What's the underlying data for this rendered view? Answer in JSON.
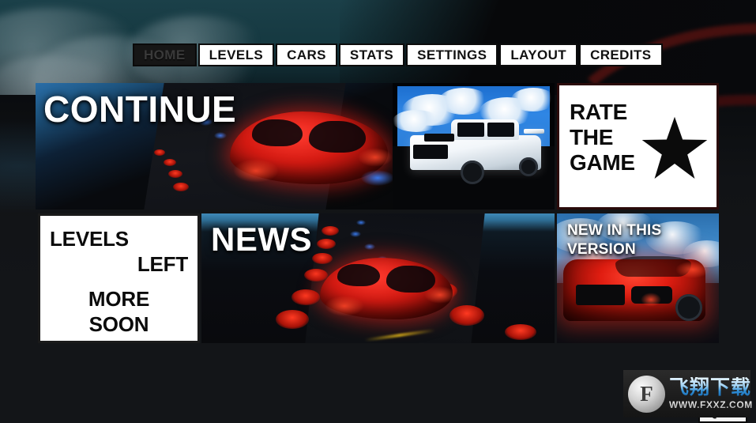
{
  "app": {
    "title": "Car Stunt Racing Game Main Menu"
  },
  "nav": {
    "tabs": [
      {
        "label": "HOME",
        "active": true,
        "name": "nav-tab-home"
      },
      {
        "label": "LEVELS",
        "active": false,
        "name": "nav-tab-levels"
      },
      {
        "label": "CARS",
        "active": false,
        "name": "nav-tab-cars"
      },
      {
        "label": "STATS",
        "active": false,
        "name": "nav-tab-stats"
      },
      {
        "label": "SETTINGS",
        "active": false,
        "name": "nav-tab-settings"
      },
      {
        "label": "LAYOUT",
        "active": false,
        "name": "nav-tab-layout"
      },
      {
        "label": "CREDITS",
        "active": false,
        "name": "nav-tab-credits"
      }
    ]
  },
  "tiles": {
    "continue": {
      "title": "CONTINUE",
      "image_desc": "red-hatchback-on-dark-track"
    },
    "truck": {
      "title": "",
      "image_desc": "white-pickup-truck-blue-sky"
    },
    "rate": {
      "line1": "RATE",
      "line2": "THE",
      "line3": "GAME",
      "icon": "star-icon"
    },
    "levels": {
      "line1": "LEVELS",
      "line2": "LEFT",
      "line3": "MORE",
      "line4": "SOON"
    },
    "news": {
      "title": "NEWS",
      "image_desc": "red-car-with-glowing-cones"
    },
    "version": {
      "line1": "NEW IN THIS",
      "line2": "VERSION",
      "image_desc": "red-car-front-view"
    }
  },
  "quit": {
    "label": "QUIT"
  },
  "watermark": {
    "logo_glyph": "F",
    "chinese": "飞翔下载",
    "url": "WWW.FXXZ.COM"
  },
  "colors": {
    "tab_active_bg": "#161616",
    "tab_active_text": "#3a3a3a",
    "tab_bg": "#ffffff",
    "tab_text": "#111111",
    "panel_white": "#ffffff",
    "panel_black_text": "#0b0b0b",
    "accent_red": "#d41a12",
    "sky_blue": "#2f86e4",
    "background_teal": "#153840"
  }
}
